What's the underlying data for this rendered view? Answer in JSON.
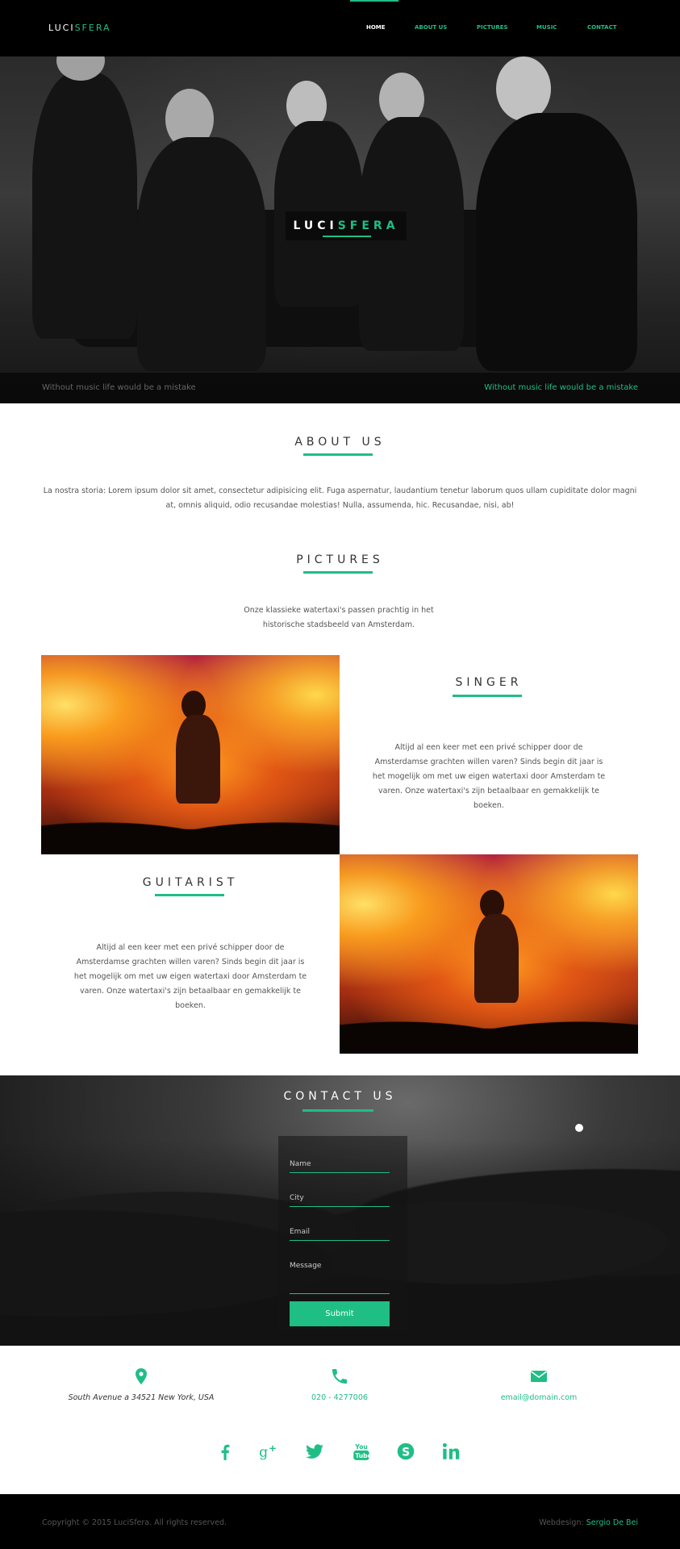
{
  "nav": {
    "logo_part1": "LUCI",
    "logo_part2": "SFERA",
    "items": [
      "HOME",
      "ABOUT US",
      "PICTURES",
      "MUSIC",
      "CONTACT"
    ]
  },
  "hero": {
    "title_part1": "LUCI",
    "title_part2": "SFERA",
    "left_caption": "Without music life would be a mistake",
    "right_caption": "Without music life would be a mistake"
  },
  "about": {
    "title": "ABOUT US",
    "text": "La nostra storia: Lorem ipsum dolor sit amet, consectetur adipisicing elit. Fuga aspernatur, laudantium tenetur laborum quos ullam cupiditate dolor magni at, omnis aliquid, odio recusandae molestias! Nulla, assumenda, hic. Recusandae, nisi, ab!"
  },
  "pictures": {
    "title": "PICTURES",
    "text": "Onze klassieke watertaxi's passen prachtig in het historische stadsbeeld van Amsterdam."
  },
  "singer": {
    "title": "SINGER",
    "text": "Altijd al een keer met een privé schipper door de Amsterdamse grachten willen varen? Sinds begin dit jaar is het mogelijk om met uw eigen watertaxi door Amsterdam te varen. Onze watertaxi's zijn betaalbaar en gemakkelijk te boeken."
  },
  "guitarist": {
    "title": "GUITARIST",
    "text": "Altijd al een keer met een privé schipper door de Amsterdamse grachten willen varen? Sinds begin dit jaar is het mogelijk om met uw eigen watertaxi door Amsterdam te varen. Onze watertaxi's zijn betaalbaar en gemakkelijk te boeken."
  },
  "contact": {
    "title": "CONTACT US",
    "name_placeholder": "Name",
    "city_placeholder": "City",
    "email_placeholder": "Email",
    "message_placeholder": "Message",
    "submit_label": "Submit"
  },
  "info": {
    "address": "South Avenue a 34521 New York, USA",
    "phone": "020 - 4277006",
    "email": "email@domain.com"
  },
  "social": [
    "facebook-icon",
    "google-plus-icon",
    "twitter-icon",
    "youtube-icon",
    "skype-icon",
    "linkedin-icon"
  ],
  "footer": {
    "copyright": "Copyright © 2015 LuciSfera. All rights reserved.",
    "credit_prefix": "Webdesign: ",
    "credit_name": "Sergio De Bei"
  },
  "colors": {
    "accent": "#1fbe85",
    "nav_bg": "#000000"
  }
}
